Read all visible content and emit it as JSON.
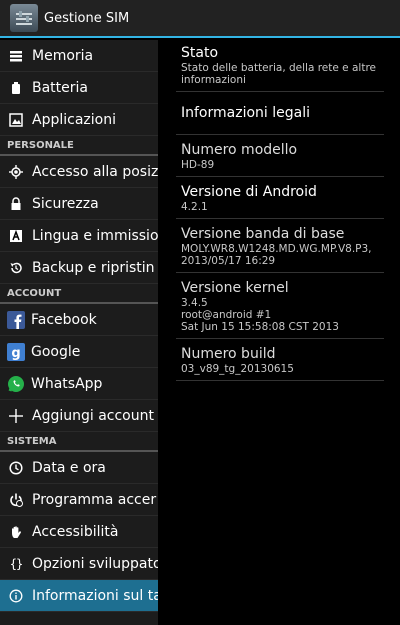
{
  "actionbar": {
    "title": "Gestione SIM"
  },
  "left": {
    "items_top": [
      {
        "label": "Memoria",
        "icon": "storage-icon"
      },
      {
        "label": "Batteria",
        "icon": "battery-icon"
      },
      {
        "label": "Applicazioni",
        "icon": "apps-icon"
      }
    ],
    "personal_header": "PERSONALE",
    "items_personal": [
      {
        "label": "Accesso alla posiz",
        "icon": "location-icon"
      },
      {
        "label": "Sicurezza",
        "icon": "lock-icon"
      },
      {
        "label": "Lingua e immissio",
        "icon": "language-icon"
      },
      {
        "label": "Backup e ripristin",
        "icon": "backup-icon"
      }
    ],
    "account_header": "ACCOUNT",
    "items_account": [
      {
        "label": "Facebook",
        "icon": "facebook-icon"
      },
      {
        "label": "Google",
        "icon": "google-icon"
      },
      {
        "label": "WhatsApp",
        "icon": "whatsapp-icon"
      },
      {
        "label": "Aggiungi account",
        "icon": "plus-icon"
      }
    ],
    "system_header": "SISTEMA",
    "items_system": [
      {
        "label": "Data e ora",
        "icon": "clock-icon"
      },
      {
        "label": "Programma accer",
        "icon": "power-schedule-icon"
      },
      {
        "label": "Accessibilità",
        "icon": "hand-icon"
      },
      {
        "label": "Opzioni sviluppato",
        "icon": "braces-icon"
      },
      {
        "label": "Informazioni sul ta",
        "icon": "info-icon"
      }
    ]
  },
  "right": {
    "status_title": "Stato",
    "status_sub": "Stato delle batteria, della rete e altre informazioni",
    "legal_title": "Informazioni legali",
    "model_title": "Numero modello",
    "model_value": "HD-89",
    "android_title": "Versione di Android",
    "android_value": "4.2.1",
    "baseband_title": "Versione banda di base",
    "baseband_value": "MOLY.WR8.W1248.MD.WG.MP.V8.P3, 2013/05/17 16:29",
    "kernel_title": "Versione kernel",
    "kernel_line1": "3.4.5",
    "kernel_line2": "root@android #1",
    "kernel_line3": "Sat Jun 15 15:58:08 CST 2013",
    "build_title": "Numero build",
    "build_value": "03_v89_tg_20130615"
  },
  "colors": {
    "accent": "#33b5e5",
    "selected": "#1e6f91"
  }
}
